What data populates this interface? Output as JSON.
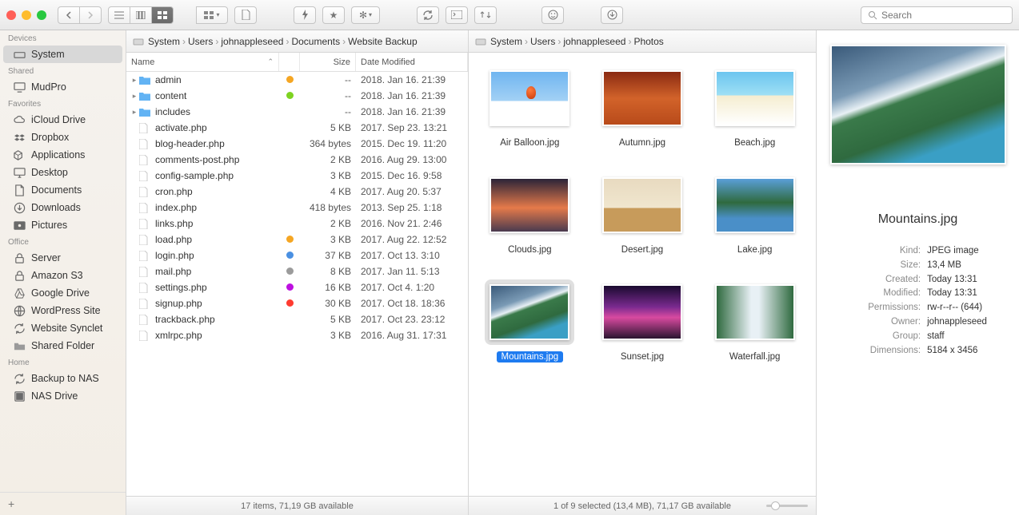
{
  "search_placeholder": "Search",
  "sidebar": {
    "sections": [
      {
        "header": "Devices",
        "items": [
          {
            "icon": "drive",
            "label": "System",
            "selected": true
          }
        ]
      },
      {
        "header": "Shared",
        "items": [
          {
            "icon": "display",
            "label": "MudPro"
          }
        ]
      },
      {
        "header": "Favorites",
        "items": [
          {
            "icon": "cloud",
            "label": "iCloud Drive"
          },
          {
            "icon": "dropbox",
            "label": "Dropbox"
          },
          {
            "icon": "apps",
            "label": "Applications"
          },
          {
            "icon": "desktop",
            "label": "Desktop"
          },
          {
            "icon": "docs",
            "label": "Documents"
          },
          {
            "icon": "downloads",
            "label": "Downloads"
          },
          {
            "icon": "pictures",
            "label": "Pictures"
          }
        ]
      },
      {
        "header": "Office",
        "items": [
          {
            "icon": "lock",
            "label": "Server"
          },
          {
            "icon": "lock",
            "label": "Amazon S3"
          },
          {
            "icon": "gdrive",
            "label": "Google Drive"
          },
          {
            "icon": "globe",
            "label": "WordPress Site"
          },
          {
            "icon": "sync",
            "label": "Website Synclet"
          },
          {
            "icon": "folder",
            "label": "Shared Folder"
          }
        ]
      },
      {
        "header": "Home",
        "items": [
          {
            "icon": "sync",
            "label": "Backup to NAS"
          },
          {
            "icon": "nas",
            "label": "NAS Drive"
          }
        ]
      }
    ]
  },
  "left_panel": {
    "path": [
      "System",
      "Users",
      "johnappleseed",
      "Documents",
      "Website Backup"
    ],
    "columns": {
      "name": "Name",
      "size": "Size",
      "date": "Date Modified"
    },
    "items": [
      {
        "type": "folder",
        "name": "admin",
        "tag": "#f5a623",
        "size": "--",
        "date": "2018. Jan 16. 21:39"
      },
      {
        "type": "folder",
        "name": "content",
        "tag": "#7ed321",
        "size": "--",
        "date": "2018. Jan 16. 21:39"
      },
      {
        "type": "folder",
        "name": "includes",
        "tag": "",
        "size": "--",
        "date": "2018. Jan 16. 21:39"
      },
      {
        "type": "file",
        "name": "activate.php",
        "tag": "",
        "size": "5 KB",
        "date": "2017. Sep 23. 13:21"
      },
      {
        "type": "file",
        "name": "blog-header.php",
        "tag": "",
        "size": "364 bytes",
        "date": "2015. Dec 19. 11:20"
      },
      {
        "type": "file",
        "name": "comments-post.php",
        "tag": "",
        "size": "2 KB",
        "date": "2016. Aug 29. 13:00"
      },
      {
        "type": "file",
        "name": "config-sample.php",
        "tag": "",
        "size": "3 KB",
        "date": "2015. Dec 16. 9:58"
      },
      {
        "type": "file",
        "name": "cron.php",
        "tag": "",
        "size": "4 KB",
        "date": "2017. Aug 20. 5:37"
      },
      {
        "type": "file",
        "name": "index.php",
        "tag": "",
        "size": "418 bytes",
        "date": "2013. Sep 25. 1:18"
      },
      {
        "type": "file",
        "name": "links.php",
        "tag": "",
        "size": "2 KB",
        "date": "2016. Nov 21. 2:46"
      },
      {
        "type": "file",
        "name": "load.php",
        "tag": "#f5a623",
        "size": "3 KB",
        "date": "2017. Aug 22. 12:52"
      },
      {
        "type": "file",
        "name": "login.php",
        "tag": "#4a90e2",
        "size": "37 KB",
        "date": "2017. Oct 13. 3:10"
      },
      {
        "type": "file",
        "name": "mail.php",
        "tag": "#9b9b9b",
        "size": "8 KB",
        "date": "2017. Jan 11. 5:13"
      },
      {
        "type": "file",
        "name": "settings.php",
        "tag": "#bd10e0",
        "size": "16 KB",
        "date": "2017. Oct 4. 1:20"
      },
      {
        "type": "file",
        "name": "signup.php",
        "tag": "#ff3b30",
        "size": "30 KB",
        "date": "2017. Oct 18. 18:36"
      },
      {
        "type": "file",
        "name": "trackback.php",
        "tag": "",
        "size": "5 KB",
        "date": "2017. Oct 23. 23:12"
      },
      {
        "type": "file",
        "name": "xmlrpc.php",
        "tag": "",
        "size": "3 KB",
        "date": "2016. Aug 31. 17:31"
      }
    ],
    "status": "17 items, 71,19 GB available"
  },
  "mid_panel": {
    "path": [
      "System",
      "Users",
      "johnappleseed",
      "Photos"
    ],
    "items": [
      {
        "name": "Air Balloon.jpg",
        "cls": "balloon"
      },
      {
        "name": "Autumn.jpg",
        "cls": "autumn"
      },
      {
        "name": "Beach.jpg",
        "cls": "beach"
      },
      {
        "name": "Clouds.jpg",
        "cls": "clouds"
      },
      {
        "name": "Desert.jpg",
        "cls": "desert"
      },
      {
        "name": "Lake.jpg",
        "cls": "lake"
      },
      {
        "name": "Mountains.jpg",
        "cls": "mountains",
        "selected": true
      },
      {
        "name": "Sunset.jpg",
        "cls": "sunset"
      },
      {
        "name": "Waterfall.jpg",
        "cls": "waterfall"
      }
    ],
    "status": "1 of 9 selected (13,4 MB), 71,17 GB available"
  },
  "preview": {
    "title": "Mountains.jpg",
    "meta": [
      {
        "k": "Kind:",
        "v": "JPEG image"
      },
      {
        "k": "Size:",
        "v": "13,4 MB"
      },
      {
        "k": "Created:",
        "v": "Today 13:31"
      },
      {
        "k": "Modified:",
        "v": "Today 13:31"
      },
      {
        "k": "Permissions:",
        "v": "rw-r--r-- (644)"
      },
      {
        "k": "Owner:",
        "v": "johnappleseed"
      },
      {
        "k": "Group:",
        "v": "staff"
      },
      {
        "k": "Dimensions:",
        "v": "5184 x 3456"
      }
    ]
  }
}
